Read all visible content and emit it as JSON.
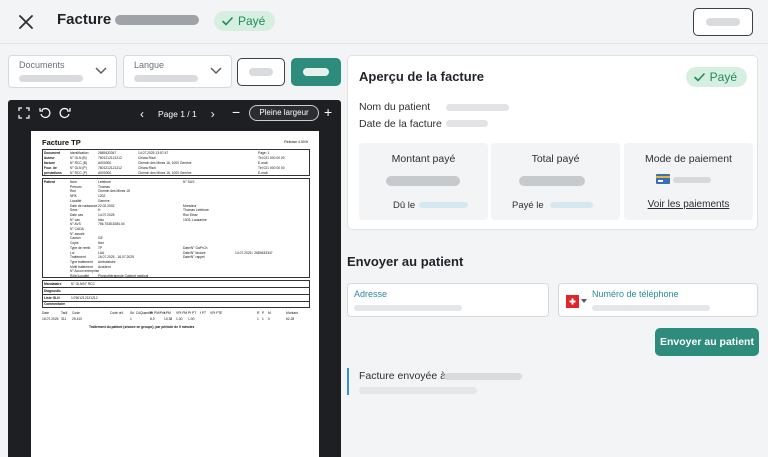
{
  "header": {
    "title": "Facture",
    "status_badge": "Payé"
  },
  "toolbar": {
    "documents_label": "Documents",
    "langue_label": "Langue"
  },
  "viewer": {
    "page_indicator": "Page 1 / 1",
    "fit_button": "Pleine largeur",
    "zoom_out": "−",
    "zoom_in": "+",
    "prev": "‹",
    "next": "›"
  },
  "invoice_doc": {
    "title": "Facture TP",
    "release": "Release 4.50/fr",
    "header_rows": [
      {
        "label": "Document",
        "k": "Identification",
        "v": "2689433347",
        "date": "14.07.2025 13:57:47",
        "right": "Page: 1"
      },
      {
        "label": "Auteur",
        "k": "N° GLN (B)",
        "v": "7601212121212",
        "date": "Chiara Rizzi",
        "right": "Tél 021 000 00 00"
      },
      {
        "label": "facture",
        "k": "N° RCC (B)",
        "v": "A000000",
        "date": "Chemin des Mines 16, 1000 Genève",
        "right": "E-mail:"
      },
      {
        "label": "Four. de",
        "k": "N° GLN (P)",
        "v": "7601212121212",
        "date": "Chiara Rizzi",
        "right": "Tél 021 000 00 00"
      },
      {
        "label": "prestations",
        "k": "N° RCC (P)",
        "v": "A000000",
        "date": "Chemin des Mines 16, 1000 Genève",
        "right": "E-mail:"
      }
    ],
    "patient_label": "Patient",
    "patient_rows": [
      {
        "k": "Nom",
        "v": "Lefebure",
        "x": "N° SUS",
        "y": ""
      },
      {
        "k": "Prénom",
        "v": "Thomas",
        "x": "",
        "y": ""
      },
      {
        "k": "Rue",
        "v": "Chemin des Mines 15",
        "x": "",
        "y": ""
      },
      {
        "k": "NPA",
        "v": "1202",
        "x": "",
        "y": ""
      },
      {
        "k": "Localité",
        "v": "Genève",
        "x": "",
        "y": ""
      },
      {
        "k": "Date de naissance",
        "v": "22.02.2002",
        "x": "Monsieur",
        "y": ""
      },
      {
        "k": "Sexe",
        "v": "H",
        "x": "Thomas Lefebure",
        "y": ""
      },
      {
        "k": "Date cas",
        "v": "14.07.2025",
        "x": "Rue Etraz",
        "y": ""
      },
      {
        "k": "N° cas",
        "v": "loko",
        "x": "1003, Lausanne",
        "y": ""
      },
      {
        "k": "N° AVS",
        "v": "756.7538.5284.04",
        "x": "",
        "y": ""
      },
      {
        "k": "N° CADA",
        "v": "",
        "x": "",
        "y": ""
      },
      {
        "k": "N° assuré",
        "v": "",
        "x": "",
        "y": ""
      },
      {
        "k": "Canton",
        "v": "GE",
        "x": "",
        "y": ""
      },
      {
        "k": "Copie",
        "v": "Non",
        "x": "",
        "y": ""
      },
      {
        "k": "Type de remb.",
        "v": "TP",
        "x": "Date/N° GaPrCh",
        "y": ""
      },
      {
        "k": "Loi",
        "v": "LAA",
        "x": "Date/N° facture",
        "y": "14.07.2025 / 2689433347"
      },
      {
        "k": "Traitement",
        "v": "16.07.2025 - 16.07.2025",
        "x": "Date/N° rappel",
        "y": ""
      },
      {
        "k": "Type traitement",
        "v": "Ambulatoire",
        "x": "",
        "y": ""
      },
      {
        "k": "Motif traitement",
        "v": "Accident",
        "x": "",
        "y": ""
      },
      {
        "k": "N° Accon entreprise",
        "v": "",
        "x": "",
        "y": ""
      },
      {
        "k": "Rôle/Localité",
        "v": "Physiothérapeute   Cabinet médical",
        "x": "",
        "y": ""
      }
    ],
    "mandataire_label": "Mandataire",
    "mandataire_value": "N° GLN/N° RCC",
    "diagnostic_label": "Diagnostic",
    "gln_label": "Liste GLN",
    "gln_value": "1/7601212121212",
    "comment_label": "Commentaire",
    "table_headers": [
      "Date",
      "Tarif",
      "Code",
      "Code réf.",
      "Sé. Cô",
      "Quantité",
      "Pt PM/Prix",
      "f PM",
      "VPt PM",
      "Pt PT",
      "f PT",
      "VPt PT",
      "E",
      "R",
      "P",
      "M",
      "Montant"
    ],
    "table_row": [
      "16.07.2025",
      "311",
      "25.410",
      "",
      "1",
      "",
      "8.0",
      "10.38",
      "1.00",
      "1.00",
      "",
      "",
      "",
      "1",
      "1",
      "0",
      "62.28"
    ],
    "table_note": "Traitement du patient (séance en groupe), par période de 5 minutes"
  },
  "summary": {
    "title": "Aperçu de la facture",
    "badge": "Payé",
    "patient_name_label": "Nom du patient",
    "invoice_date_label": "Date de la facture",
    "amount_paid_title": "Montant payé",
    "amount_paid_sub": "Dû le",
    "total_paid_title": "Total payé",
    "total_paid_sub": "Payé le",
    "payment_mode_title": "Mode de paiement",
    "payments_link": "Voir les paiements"
  },
  "send": {
    "title": "Envoyer au patient",
    "address_label": "Adresse",
    "phone_label": "Numéro de téléphone",
    "send_button": "Envoyer au patient",
    "sent_label": "Facture envoyée à"
  },
  "colors": {
    "accent": "#2d8c7b",
    "paid_bg": "#d7efe1",
    "paid_text": "#1f8a5b",
    "field_label": "#2a8a9c",
    "sent_bar": "#3b8fd0"
  }
}
